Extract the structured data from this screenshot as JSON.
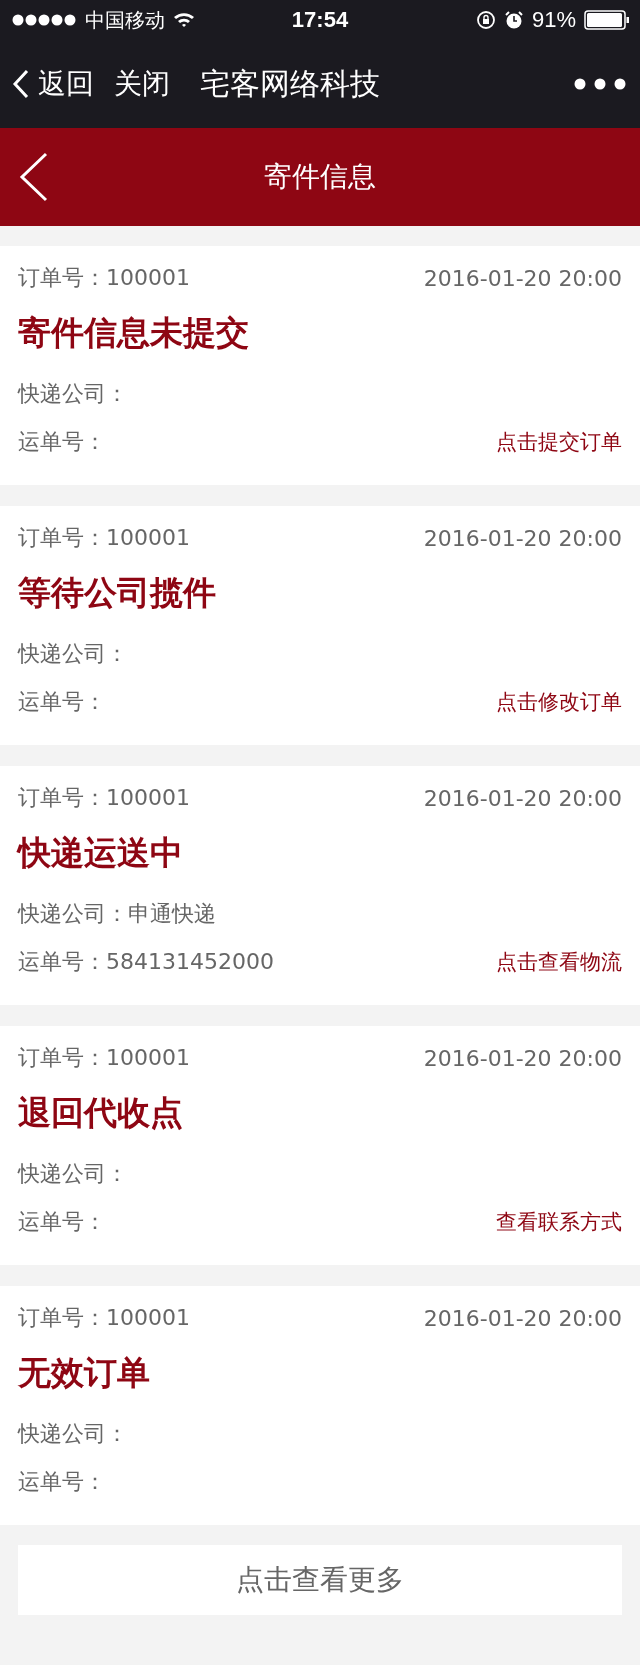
{
  "status_bar": {
    "carrier": "中国移动",
    "time": "17:54",
    "battery": "91%"
  },
  "nav_bar": {
    "back": "返回",
    "close": "关闭",
    "title": "宅客网络科技"
  },
  "header": {
    "title": "寄件信息"
  },
  "orders": [
    {
      "order_no": "订单号：100001",
      "time": "2016-01-20 20:00",
      "status": "寄件信息未提交",
      "company_label": "快递公司：",
      "waybill_label": "运单号：",
      "action": "点击提交订单"
    },
    {
      "order_no": "订单号：100001",
      "time": "2016-01-20 20:00",
      "status": "等待公司揽件",
      "company_label": "快递公司：",
      "waybill_label": "运单号：",
      "action": "点击修改订单"
    },
    {
      "order_no": "订单号：100001",
      "time": "2016-01-20 20:00",
      "status": "快递运送中",
      "company_label": "快递公司：",
      "company": "申通快递",
      "waybill_label": "运单号：",
      "waybill": "584131452000",
      "action": "点击查看物流"
    },
    {
      "order_no": "订单号：100001",
      "time": "2016-01-20 20:00",
      "status": "退回代收点",
      "company_label": "快递公司：",
      "waybill_label": "运单号：",
      "action": "查看联系方式"
    },
    {
      "order_no": "订单号：100001",
      "time": "2016-01-20 20:00",
      "status": "无效订单",
      "company_label": "快递公司：",
      "waybill_label": "运单号："
    }
  ],
  "more_button": "点击查看更多"
}
